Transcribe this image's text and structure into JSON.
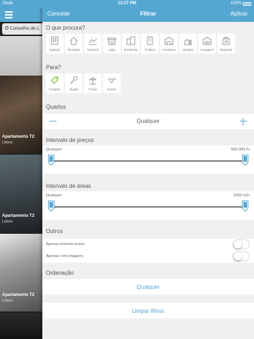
{
  "status": {
    "carrier": "Rede",
    "time": "12:37 PM",
    "battery": "100%"
  },
  "background": {
    "search_text": "Concelho de L",
    "listings": [
      {
        "title": "",
        "location": ""
      },
      {
        "title": "Apartamento T2",
        "location": "Lisboa"
      },
      {
        "title": "Apartamento T2",
        "location": "Lisboa"
      },
      {
        "title": "Apartamento T2",
        "location": "Lisboa"
      },
      {
        "title": "",
        "location": ""
      }
    ]
  },
  "nav": {
    "cancel": "Cancelar",
    "title": "Filtrar",
    "apply": "Aplicar"
  },
  "property_types": {
    "label": "O que procura?",
    "items": [
      {
        "label": "Apartam",
        "icon": "apartment-icon"
      },
      {
        "label": "Moradias",
        "icon": "house-icon"
      },
      {
        "label": "Terrenos",
        "icon": "land-icon"
      },
      {
        "label": "Lojas",
        "icon": "shop-icon"
      },
      {
        "label": "Escritórios",
        "icon": "office-icon"
      },
      {
        "label": "Prédios",
        "icon": "building-icon"
      },
      {
        "label": "Armazéns",
        "icon": "warehouse-icon"
      },
      {
        "label": "Quintas",
        "icon": "farm-icon"
      },
      {
        "label": "Garagens",
        "icon": "garage-icon"
      },
      {
        "label": "Negócios",
        "icon": "business-icon"
      }
    ]
  },
  "purpose": {
    "label": "Para?",
    "items": [
      {
        "label": "Comprar",
        "icon": "buy-tag-icon",
        "active": true
      },
      {
        "label": "Alugar",
        "icon": "key-icon",
        "active": false
      },
      {
        "label": "Férias",
        "icon": "vacation-icon",
        "active": false
      },
      {
        "label": "Outros",
        "icon": "handshake-icon",
        "active": false
      }
    ]
  },
  "rooms": {
    "label": "Quartos",
    "value": "Qualquer"
  },
  "price": {
    "label": "Intervalo de preços",
    "min": "Qualquer",
    "max": "500.000 €+"
  },
  "area": {
    "label": "Intervalo de áreas",
    "min": "Qualquer",
    "max": "1000 m2+"
  },
  "others": {
    "label": "Outros",
    "options": [
      {
        "label": "Apenas imóveis novos",
        "on": false
      },
      {
        "label": "Apenas com imagens",
        "on": false
      }
    ]
  },
  "sorting": {
    "label": "Ordenação",
    "value": "Qualquer"
  },
  "clear_button": "Limpar filtros",
  "colors": {
    "accent": "#55a7d2",
    "active_green": "#8bc34a",
    "panel_bg": "#f0f0f0"
  }
}
